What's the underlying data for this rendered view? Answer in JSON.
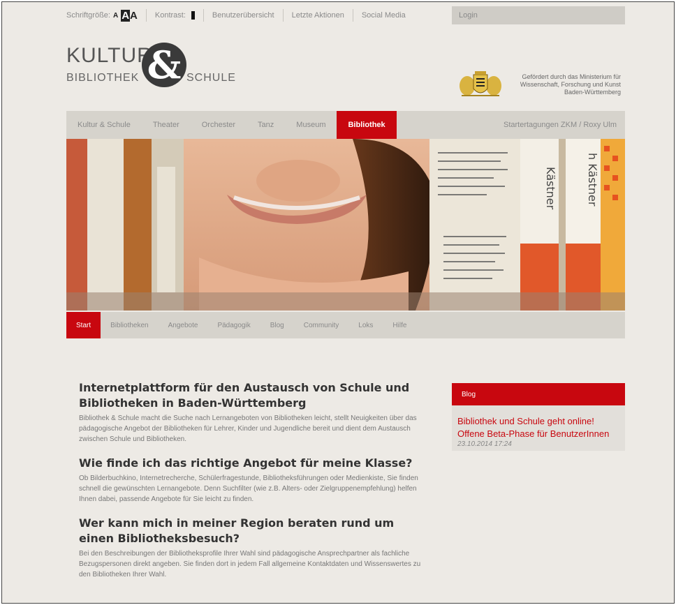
{
  "topbar": {
    "font_size_label": "Schriftgröße:",
    "font_small": "A",
    "font_large_a": "A",
    "font_large_b": "A",
    "contrast_label": "Kontrast:",
    "links": [
      "Benutzerübersicht",
      "Letzte Aktionen",
      "Social Media"
    ],
    "login": "Login"
  },
  "logo": {
    "line1": "KULTUR",
    "amp": "&",
    "left": "BIBLIOTHEK",
    "right": "SCHULE"
  },
  "sponsor": {
    "text": "Gefördert durch das Ministerium für Wissenschaft, Forschung und Kunst Baden-Württemberg"
  },
  "mainnav": {
    "items": [
      "Kultur & Schule",
      "Theater",
      "Orchester",
      "Tanz",
      "Museum",
      "Bibliothek"
    ],
    "right": "Startertagungen ZKM / Roxy Ulm"
  },
  "subnav": {
    "items": [
      "Start",
      "Bibliotheken",
      "Angebote",
      "Pädagogik",
      "Blog",
      "Community",
      "Loks",
      "Hilfe"
    ]
  },
  "hero": {
    "book1": "Kästner",
    "book2": "h Kästner"
  },
  "content": {
    "sections": [
      {
        "title": "Internetplattform für den Austausch von Schule und Bibliotheken in Baden-Württemberg",
        "text": "Bibliothek & Schule macht die Suche nach Lernangeboten von Bibliotheken leicht, stellt Neuigkeiten über das pädagogische Angebot der Bibliotheken für Lehrer, Kinder und Jugendliche bereit und dient dem Austausch zwischen Schule und Bibliotheken."
      },
      {
        "title": "Wie finde ich das richtige Angebot für meine Klasse?",
        "text": "Ob Bilderbuchkino, Internetrecherche, Schülerfragestunde, Bibliotheksführungen oder Medienkiste, Sie finden schnell die gewünschten Lernangebote. Denn Suchfilter (wie z.B. Alters- oder Zielgruppenempfehlung) helfen Ihnen dabei, passende Angebote für Sie leicht zu finden."
      },
      {
        "title": "Wer kann mich in meiner Region beraten rund um einen Bibliotheksbesuch?",
        "text": "Bei den Beschreibungen der Bibliotheksprofile Ihrer Wahl sind pädagogische Ansprechpartner als fachliche Bezugspersonen direkt angeben. Sie finden dort in jedem Fall allgemeine Kontaktdaten und Wissenswertes zu den Bibliotheken Ihrer Wahl."
      }
    ]
  },
  "blog": {
    "heading": "Blog",
    "title": "Bibliothek und Schule geht online! Offene Beta-Phase für BenutzerInnen",
    "date": "23.10.2014 17:24"
  },
  "colors": {
    "accent": "#c8070f",
    "background": "#edeae5",
    "nav": "#d6d3cc"
  }
}
